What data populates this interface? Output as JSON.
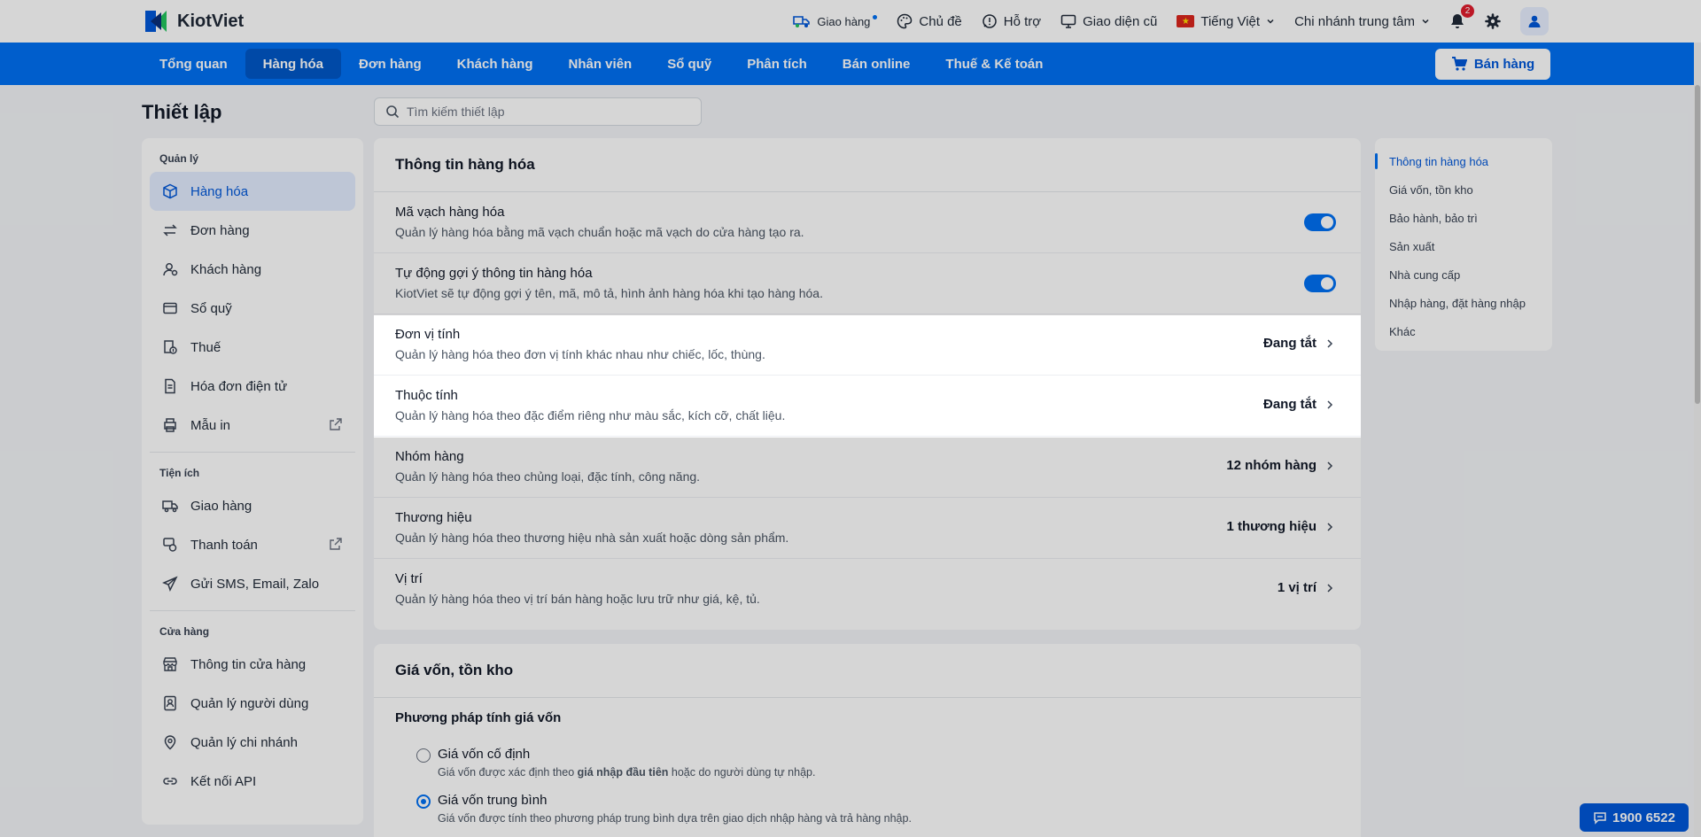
{
  "header": {
    "brand": "KiotViet",
    "actions": {
      "delivery": "Giao hàng",
      "theme": "Chủ đề",
      "support": "Hỗ trợ",
      "old_ui": "Giao diện cũ",
      "language": "Tiếng Việt",
      "branch": "Chi nhánh trung tâm",
      "notifications_count": "2"
    }
  },
  "nav": {
    "items": [
      "Tổng quan",
      "Hàng hóa",
      "Đơn hàng",
      "Khách hàng",
      "Nhân viên",
      "Sổ quỹ",
      "Phân tích",
      "Bán online",
      "Thuế & Kế toán"
    ],
    "active": "Hàng hóa",
    "sell_button": "Bán hàng"
  },
  "page": {
    "title": "Thiết lập",
    "search_placeholder": "Tìm kiếm thiết lập"
  },
  "sidebar": {
    "sections": [
      {
        "heading": "Quản lý",
        "items": [
          {
            "label": "Hàng hóa",
            "icon": "box-icon",
            "active": true
          },
          {
            "label": "Đơn hàng",
            "icon": "swap-arrows-icon"
          },
          {
            "label": "Khách hàng",
            "icon": "user-icon"
          },
          {
            "label": "Sổ quỹ",
            "icon": "wallet-icon"
          },
          {
            "label": "Thuế",
            "icon": "tax-document-icon"
          },
          {
            "label": "Hóa đơn điện tử",
            "icon": "invoice-icon"
          },
          {
            "label": "Mẫu in",
            "icon": "printer-icon",
            "external": true
          }
        ]
      },
      {
        "heading": "Tiện ích",
        "items": [
          {
            "label": "Giao hàng",
            "icon": "truck-icon"
          },
          {
            "label": "Thanh toán",
            "icon": "payment-icon",
            "external": true
          },
          {
            "label": "Gửi SMS, Email, Zalo",
            "icon": "send-icon"
          }
        ]
      },
      {
        "heading": "Cửa hàng",
        "items": [
          {
            "label": "Thông tin cửa hàng",
            "icon": "store-icon"
          },
          {
            "label": "Quản lý người dùng",
            "icon": "user-badge-icon"
          },
          {
            "label": "Quản lý chi nhánh",
            "icon": "location-pin-icon"
          },
          {
            "label": "Kết nối API",
            "icon": "link-icon"
          }
        ]
      }
    ]
  },
  "product_info": {
    "title": "Thông tin hàng hóa",
    "rows": [
      {
        "title": "Mã vạch hàng hóa",
        "desc": "Quản lý hàng hóa bằng mã vạch chuẩn hoặc mã vạch do cửa hàng tạo ra.",
        "toggle": true
      },
      {
        "title": "Tự động gợi ý thông tin hàng hóa",
        "desc": "KiotViet sẽ tự động gợi ý tên, mã, mô tả, hình ảnh hàng hóa khi tạo hàng hóa.",
        "toggle": true
      },
      {
        "title": "Đơn vị tính",
        "desc": "Quản lý hàng hóa theo đơn vị tính khác nhau như chiếc, lốc, thùng.",
        "value": "Đang tắt"
      },
      {
        "title": "Thuộc tính",
        "desc": "Quản lý hàng hóa theo đặc điểm riêng như màu sắc, kích cỡ, chất liệu.",
        "value": "Đang tắt"
      },
      {
        "title": "Nhóm hàng",
        "desc": "Quản lý hàng hóa theo chủng loại, đặc tính, công năng.",
        "value": "12 nhóm hàng"
      },
      {
        "title": "Thương hiệu",
        "desc": "Quản lý hàng hóa theo thương hiệu nhà sản xuất hoặc dòng sản phẩm.",
        "value": "1 thương hiệu"
      },
      {
        "title": "Vị trí",
        "desc": "Quản lý hàng hóa theo vị trí bán hàng hoặc lưu trữ như giá, kệ, tủ.",
        "value": "1 vị trí"
      }
    ]
  },
  "cost_inventory": {
    "title": "Giá vốn, tồn kho",
    "method_title": "Phương pháp tính giá vốn",
    "options": [
      {
        "label": "Giá vốn cố định",
        "desc_prefix": "Giá vốn được xác định theo ",
        "desc_bold": "giá nhập đầu tiên",
        "desc_suffix": " hoặc do người dùng tự nhập.",
        "checked": false
      },
      {
        "label": "Giá vốn trung bình",
        "desc": "Giá vốn được tính theo phương pháp trung bình dựa trên giao dịch nhập hàng và trả hàng nhập.",
        "checked": true
      }
    ]
  },
  "toc": {
    "items": [
      "Thông tin hàng hóa",
      "Giá vốn, tồn kho",
      "Bảo hành, bảo trì",
      "Sản xuất",
      "Nhà cung cấp",
      "Nhập hàng, đặt hàng nhập",
      "Khác"
    ],
    "active": 0
  },
  "hotline": "1900 6522",
  "colors": {
    "primary": "#0070f4",
    "primary_dark": "#0057d9",
    "page_bg": "#f2f4f7"
  }
}
